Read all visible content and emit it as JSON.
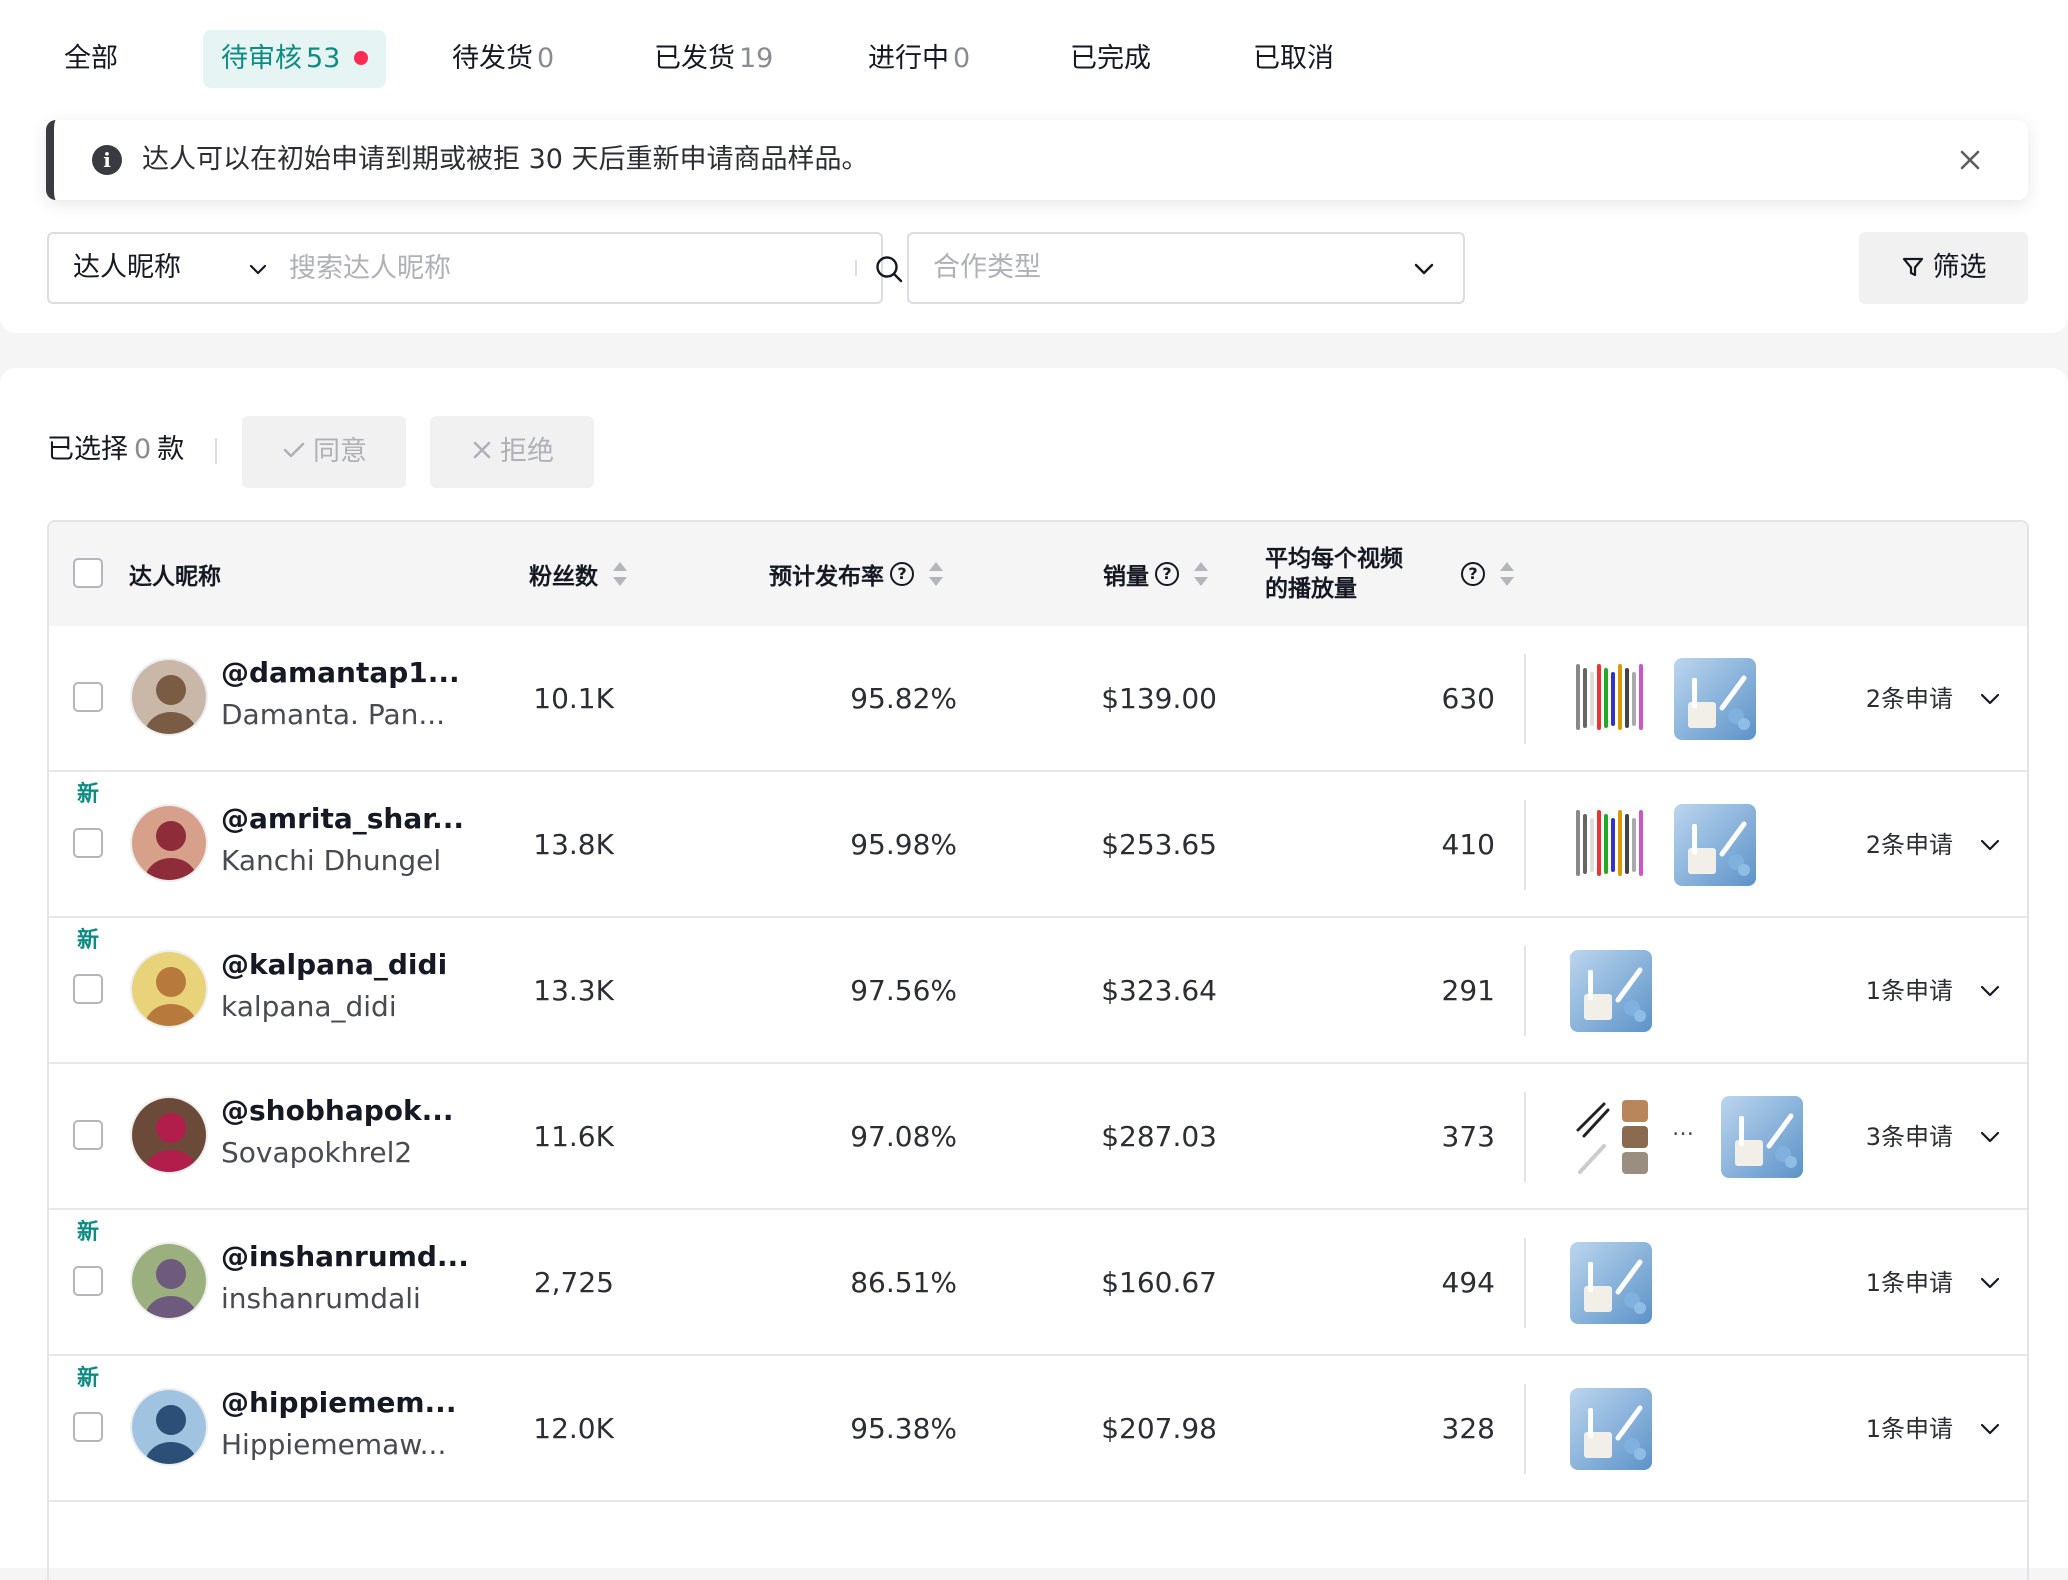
{
  "tabs": [
    {
      "label": "全部",
      "count": ""
    },
    {
      "label": "待审核",
      "count": "53"
    },
    {
      "label": "待发货",
      "count": "0"
    },
    {
      "label": "已发货",
      "count": "19"
    },
    {
      "label": "进行中",
      "count": "0"
    },
    {
      "label": "已完成",
      "count": ""
    },
    {
      "label": "已取消",
      "count": ""
    }
  ],
  "active_tab": "待审核",
  "notice": {
    "text": "达人可以在初始申请到期或被拒 30 天后重新申请商品样品。"
  },
  "search": {
    "dropdown_label": "达人昵称",
    "placeholder": "搜索达人昵称"
  },
  "coop_select": {
    "placeholder": "合作类型"
  },
  "filter_button": "筛选",
  "selection": {
    "prefix": "已选择",
    "count": "0",
    "suffix": "款"
  },
  "actions": {
    "approve": "同意",
    "reject": "拒绝"
  },
  "table": {
    "headers": {
      "creator": "达人昵称",
      "followers": "粉丝数",
      "post_rate": "预计发布率",
      "sales": "销量",
      "avg_views_line1": "平均每个视频",
      "avg_views_line2": "的播放量"
    },
    "rows": [
      {
        "new_tag": "",
        "handle": "@damantap1...",
        "name": "Damanta. Pan...",
        "followers": "10.1K",
        "post_rate": "95.82%",
        "sales": "$139.00",
        "avg_views": "630",
        "requests": "2条申请"
      },
      {
        "new_tag": "新",
        "handle": "@amrita_shar...",
        "name": "Kanchi Dhungel",
        "followers": "13.8K",
        "post_rate": "95.98%",
        "sales": "$253.65",
        "avg_views": "410",
        "requests": "2条申请"
      },
      {
        "new_tag": "新",
        "handle": "@kalpana_didi",
        "name": "kalpana_didi",
        "followers": "13.3K",
        "post_rate": "97.56%",
        "sales": "$323.64",
        "avg_views": "291",
        "requests": "1条申请"
      },
      {
        "new_tag": "",
        "handle": "@shobhapok...",
        "name": "Sovapokhrel2",
        "followers": "11.6K",
        "post_rate": "97.08%",
        "sales": "$287.03",
        "avg_views": "373",
        "requests": "3条申请"
      },
      {
        "new_tag": "新",
        "handle": "@inshanrumd...",
        "name": "inshanrumdali",
        "followers": "2,725",
        "post_rate": "86.51%",
        "sales": "$160.67",
        "avg_views": "494",
        "requests": "1条申请"
      },
      {
        "new_tag": "新",
        "handle": "@hippiemem...",
        "name": "Hippiememaw...",
        "followers": "12.0K",
        "post_rate": "95.38%",
        "sales": "$207.98",
        "avg_views": "328",
        "requests": "1条申请"
      }
    ]
  },
  "colors": {
    "accent": "#0e8c84",
    "alert_dot": "#fe2c55"
  }
}
